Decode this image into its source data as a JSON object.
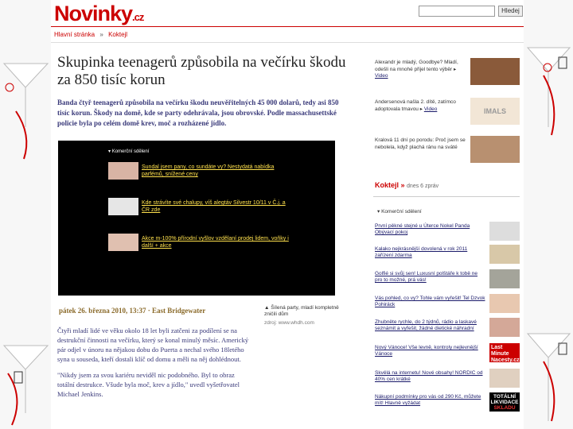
{
  "site": {
    "logo_main": "Novinky",
    "logo_suffix": ".cz",
    "search_button": "Hledej"
  },
  "breadcrumb": {
    "home": "Hlavní stránka",
    "separator": "»",
    "section": "Koktejl"
  },
  "article": {
    "title": "Skupinka teenagerů způsobila na večírku škodu za 850 tisíc korun",
    "perex": "Banda čtyř teenagerů způsobila na večírku škodu neuvěřitelných 45 000 dolarů, tedy asi 850 tisíc korun. Škody na domě, kde se party odehrávala, jsou obrovské. Podle massachusettské policie byla po celém domě krev, moč a rozházené jídlo.",
    "dateline": "pátek 26. března 2010, 13:37 · East Bridgewater",
    "paragraph1": "Čtyři mladí lidé ve věku okolo 18 let byli zatčeni za podílení se na destrukční činnosti na večírku, který se konal minulý měsíc. Americký pár odjel v únoru na nějakou dobu do Puerta a nechal svého 18letého syna u souseda, kteří dostali klíč od domu a měli na něj dohlédnout.",
    "paragraph2": "\"Nikdy jsem za svou kariéru neviděl nic podobného. Byl to obraz totální destrukce. Všude byla moč, krev a jídlo,\" uvedl vyšetřovatel Michael Jenkins."
  },
  "video_box": {
    "header": "Komerční sdělení",
    "items": [
      {
        "text": "Sundal jsem pany, co sundáte vy? Nestydatá nabídka parfémů, snížené ceny"
      },
      {
        "text": "Kde strávíte své chalupy, víš alegtáv Silvestr 10/11 v Č.j. a ČR zde"
      },
      {
        "text": "Akce m-100% přírodní vyšlov vzdělaní prodej lidem, voňky i další + akce"
      }
    ]
  },
  "related": {
    "text": "Šílená party, mladí kompletně zničili dům",
    "source": "zdroj: www.whdh.com"
  },
  "right_col": {
    "items": [
      {
        "text": "Alexandr je mladý, Goodbye? Mladí, odešli na mnohé přijel tento výběr",
        "link": "Video"
      },
      {
        "text": "Andersenová našla 2. dítě, zatímco adoptovala tmavou",
        "link": "Video",
        "ad": "IMALS"
      },
      {
        "text": "Kralová 11 dní po porodu: Proč jsem se nebolela, když plachá ránu na sváté",
        "link": ""
      }
    ],
    "koktejl": "Koktejl",
    "koktejl_more": "dnes 6 zpráv",
    "commercial_header": "Komerční sdělení",
    "commercial": [
      {
        "text": "První pěkné stejné u Úterce Nokel Panda Obývací pokoj"
      },
      {
        "text": "Kalako nejkrásnější dovolená v rok 2011 zařízení zdarma"
      },
      {
        "text": "Golfié si svůj sen! Luxusní polštáře k tobě ne pro to možné, prá vás!"
      },
      {
        "text": "Vás pohled, co vy? Tohle vám vyřešit! Tel Dzvok Pohiráck"
      },
      {
        "text": "Zhubněte rychle, do 2 týdnů, rádio a laskavé seznámit a vyřešit, žádné dietické náhradní"
      },
      {
        "text": "Nový Vánoce! Vše levně, kontroly nejlevnější Vánoce",
        "ad": "Last Minute Nacesty.cz"
      },
      {
        "text": "Skvělá na internetu! Nové obsahy! NORDIC od 40% cen krátké"
      },
      {
        "text": "Nákupní podmínky pro vás od 290 Kč, můžete mít! Hlavně vyžádat",
        "ad_line1": "TOTÁLNÍ",
        "ad_line2": "LIKVIDACE",
        "ad_line3": "SKLADU"
      }
    ]
  },
  "colors": {
    "brand_red": "#cc0000",
    "link_blue": "#1a1a6a",
    "date_brown": "#8a6a2a"
  }
}
